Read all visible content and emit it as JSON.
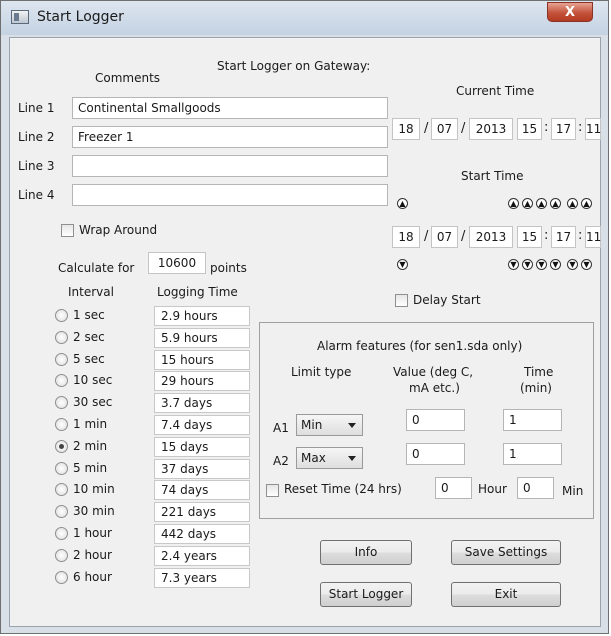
{
  "window": {
    "title": "Start Logger",
    "close_label": "X"
  },
  "header": {
    "gateway_label": "Start Logger on Gateway:",
    "comments_label": "Comments"
  },
  "comments": {
    "lines": [
      {
        "label": "Line 1",
        "value": "Continental Smallgoods"
      },
      {
        "label": "Line 2",
        "value": "Freezer 1"
      },
      {
        "label": "Line 3",
        "value": ""
      },
      {
        "label": "Line 4",
        "value": ""
      }
    ]
  },
  "wrap_around": {
    "label": "Wrap Around",
    "checked": false
  },
  "calculate": {
    "prefix": "Calculate for",
    "points": "10600",
    "suffix": "points"
  },
  "intervals": {
    "interval_header": "Interval",
    "logging_header": "Logging Time",
    "selected": "2 min",
    "rows": [
      {
        "interval": "1 sec",
        "time": "2.9 hours"
      },
      {
        "interval": "2 sec",
        "time": "5.9 hours"
      },
      {
        "interval": "5 sec",
        "time": "15  hours"
      },
      {
        "interval": "10 sec",
        "time": "29  hours"
      },
      {
        "interval": "30 sec",
        "time": "3.7 days"
      },
      {
        "interval": "1 min",
        "time": "7.4 days"
      },
      {
        "interval": "2 min",
        "time": "15  days"
      },
      {
        "interval": "5 min",
        "time": "37  days"
      },
      {
        "interval": "10 min",
        "time": "74  days"
      },
      {
        "interval": "30 min",
        "time": "221  days"
      },
      {
        "interval": "1 hour",
        "time": "442  days"
      },
      {
        "interval": "2 hour",
        "time": "2.4 years"
      },
      {
        "interval": "6 hour",
        "time": "7.3 years"
      }
    ]
  },
  "current_time": {
    "label": "Current Time",
    "day": "18",
    "month": "07",
    "year": "2013",
    "hour": "15",
    "minute": "17",
    "second": "11"
  },
  "start_time": {
    "label": "Start Time",
    "day": "18",
    "month": "07",
    "year": "2013",
    "hour": "15",
    "minute": "17",
    "second": "11"
  },
  "separators": {
    "date": "/",
    "time": ":"
  },
  "delay_start": {
    "label": "Delay Start",
    "checked": false
  },
  "alarm": {
    "title": "Alarm features (for sen1.sda only)",
    "limit_type_header": "Limit type",
    "value_header_1": "Value (deg C,",
    "value_header_2": "mA etc.)",
    "time_header_1": "Time",
    "time_header_2": "(min)",
    "rows": [
      {
        "label": "A1",
        "type": "Min",
        "value": "0",
        "time": "1"
      },
      {
        "label": "A2",
        "type": "Max",
        "value": "0",
        "time": "1"
      }
    ],
    "reset": {
      "label": "Reset Time (24 hrs)",
      "hour": "0",
      "hour_label": "Hour",
      "min": "0",
      "min_label": "Min",
      "checked": false
    }
  },
  "buttons": {
    "info": "Info",
    "save_settings": "Save Settings",
    "start_logger": "Start Logger",
    "exit": "Exit"
  }
}
